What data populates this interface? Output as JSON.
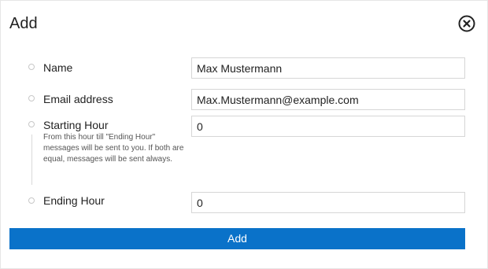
{
  "dialog": {
    "title": "Add",
    "close_icon": "close-circle-icon"
  },
  "fields": {
    "name": {
      "label": "Name",
      "value": "Max Mustermann"
    },
    "email": {
      "label": "Email address",
      "value": "Max.Mustermann@example.com"
    },
    "starting_hour": {
      "label": "Starting Hour",
      "value": "0",
      "hint": "From this hour till \"Ending Hour\" messages will be sent to you. If both are equal, messages will be sent always."
    },
    "ending_hour": {
      "label": "Ending Hour",
      "value": "0"
    }
  },
  "actions": {
    "add_label": "Add"
  },
  "colors": {
    "primary_button": "#0a72c9",
    "field_border": "#d6d6d6"
  }
}
